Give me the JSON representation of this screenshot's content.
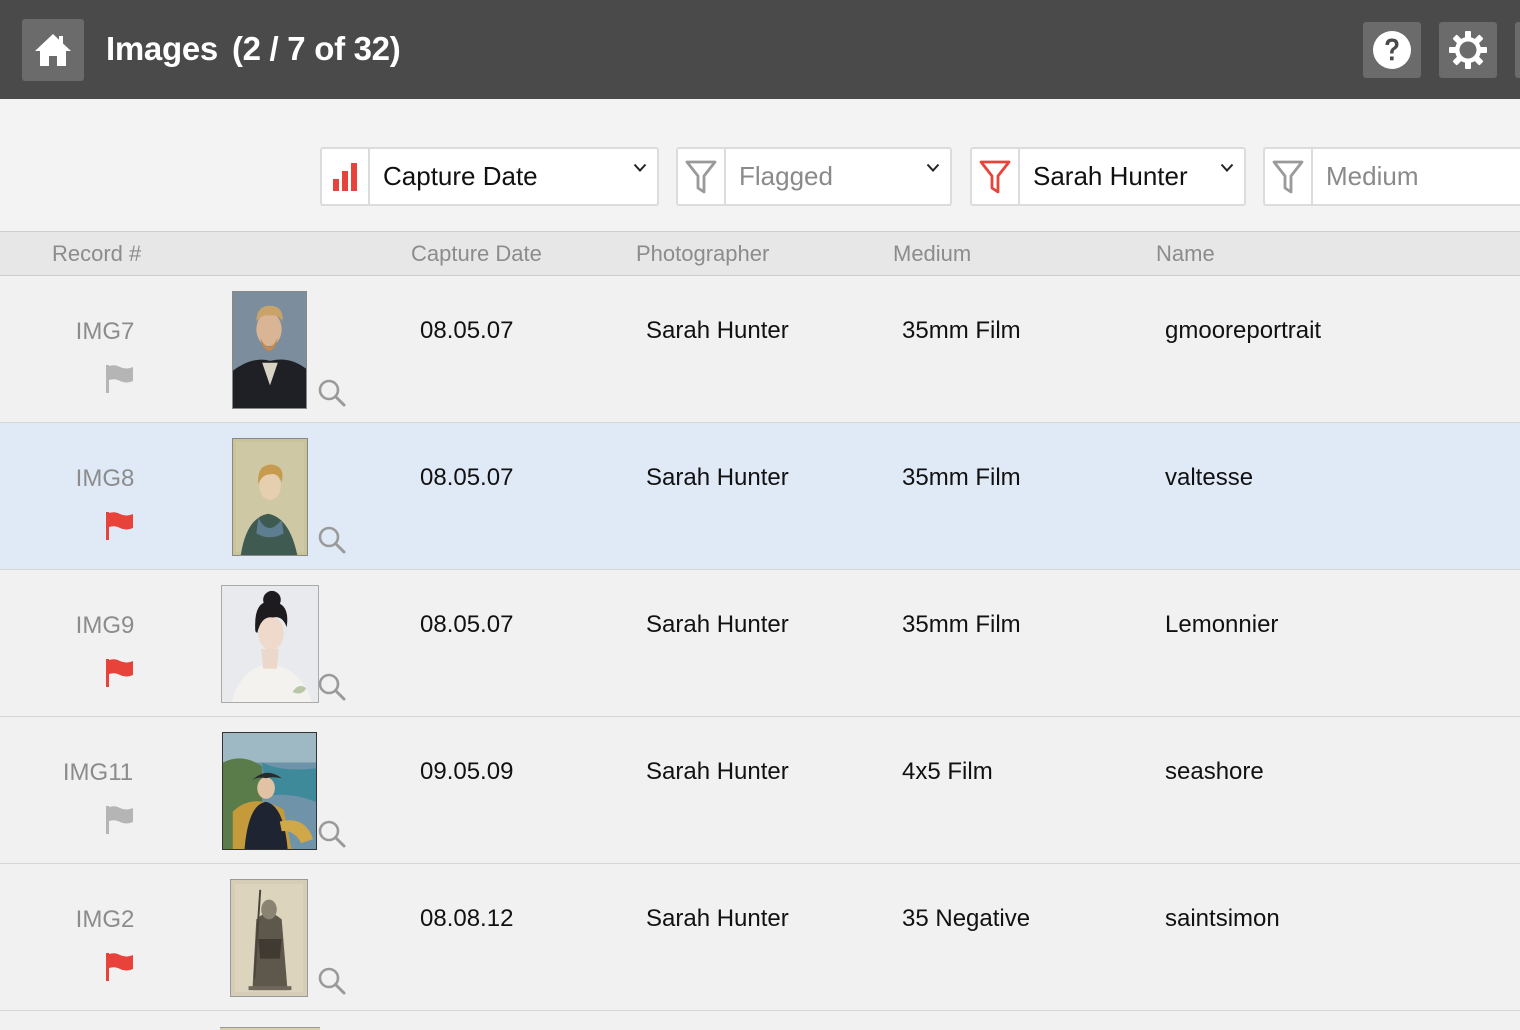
{
  "header": {
    "title": "Images",
    "count": "(2 / 7 of 32)",
    "home_icon": "home-icon",
    "help_icon": "help-icon",
    "settings_icon": "gear-icon",
    "bg_color": "#4a4a4a",
    "button_color": "#6b6b6b"
  },
  "toolbar": {
    "sort": {
      "label": "Capture Date",
      "icon": "bar-chart-icon",
      "active": true
    },
    "filters": [
      {
        "label": "Flagged",
        "icon": "filter-icon",
        "active": false
      },
      {
        "label": "Sarah Hunter",
        "icon": "filter-icon",
        "active": true
      },
      {
        "label": "Medium",
        "icon": "filter-icon",
        "active": false
      }
    ],
    "accent_color": "#e8433a"
  },
  "columns": {
    "record": "Record #",
    "capture_date": "Capture Date",
    "photographer": "Photographer",
    "medium": "Medium",
    "name": "Name"
  },
  "rows": [
    {
      "record": "IMG7",
      "flagged": false,
      "capture_date": "08.05.07",
      "photographer": "Sarah Hunter",
      "medium": "35mm Film",
      "name": "gmooreportrait",
      "selected": false
    },
    {
      "record": "IMG8",
      "flagged": true,
      "capture_date": "08.05.07",
      "photographer": "Sarah Hunter",
      "medium": "35mm Film",
      "name": "valtesse",
      "selected": true
    },
    {
      "record": "IMG9",
      "flagged": true,
      "capture_date": "08.05.07",
      "photographer": "Sarah Hunter",
      "medium": "35mm Film",
      "name": "Lemonnier",
      "selected": false
    },
    {
      "record": "IMG11",
      "flagged": false,
      "capture_date": "09.05.09",
      "photographer": "Sarah Hunter",
      "medium": "4x5 Film",
      "name": "seashore",
      "selected": false
    },
    {
      "record": "IMG2",
      "flagged": true,
      "capture_date": "08.08.12",
      "photographer": "Sarah Hunter",
      "medium": "35 Negative",
      "name": "saintsimon",
      "selected": false
    }
  ],
  "colors": {
    "flag_on": "#e8433a",
    "flag_off": "#b5b5b5",
    "selected_row": "#e0eaf7"
  }
}
